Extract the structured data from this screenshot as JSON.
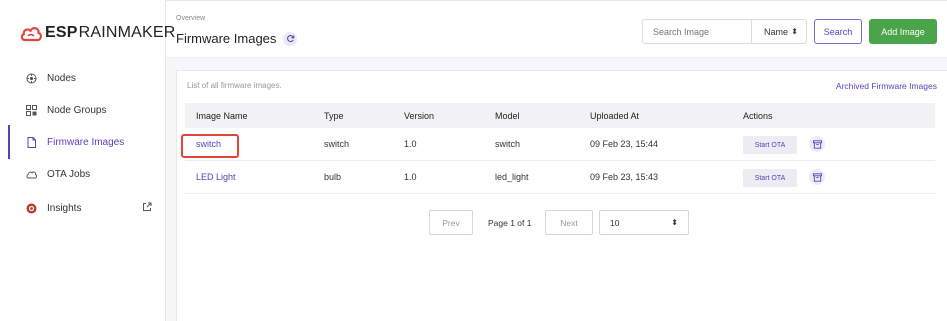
{
  "brand": {
    "strong": "ESP",
    "rest": "RAINMAKER",
    "accent": "#e2463c"
  },
  "sidebar": {
    "items": [
      {
        "label": "Nodes",
        "icon": "nodes-icon"
      },
      {
        "label": "Node Groups",
        "icon": "node-groups-icon"
      },
      {
        "label": "Firmware Images",
        "icon": "firmware-file-icon",
        "active": true
      },
      {
        "label": "OTA Jobs",
        "icon": "ota-cloud-icon"
      },
      {
        "label": "Insights",
        "icon": "insights-icon",
        "external": true
      }
    ]
  },
  "header": {
    "breadcrumb": "Overview",
    "title": "Firmware Images",
    "search_placeholder": "Search Image",
    "sort_value": "Name",
    "search_label": "Search",
    "add_label": "Add Image"
  },
  "main": {
    "caption": "List of all firmware images.",
    "archived_link": "Archived Firmware Images",
    "columns": [
      "Image Name",
      "Type",
      "Version",
      "Model",
      "Uploaded At",
      "Actions"
    ],
    "rows": [
      {
        "name": "switch",
        "type": "switch",
        "version": "1.0",
        "model": "switch",
        "uploaded": "09 Feb 23, 15:44",
        "action": "Start OTA",
        "highlighted": true
      },
      {
        "name": "LED Light",
        "type": "bulb",
        "version": "1.0",
        "model": "led_light",
        "uploaded": "09 Feb 23, 15:43",
        "action": "Start OTA"
      }
    ],
    "pagination": {
      "prev": "Prev",
      "page_text": "Page 1 of 1",
      "next": "Next",
      "per_page": "10"
    }
  },
  "colors": {
    "accent": "#5b3fb8",
    "add_button": "#4aa44a",
    "highlight": "#e0453a"
  }
}
